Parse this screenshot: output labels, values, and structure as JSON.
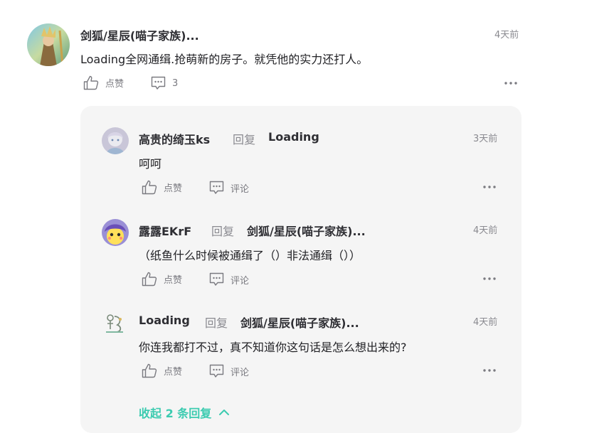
{
  "comment": {
    "username": "剑狐/星辰(喵子家族)...",
    "time": "4天前",
    "content": "Loading全网通缉.抢萌新的房子。就凭他的实力还打人。",
    "like_label": "点赞",
    "reply_count": "3"
  },
  "replies": [
    {
      "username": "高贵的绮玉ks",
      "reply_word": "回复",
      "target": "Loading",
      "time": "3天前",
      "content": "呵呵",
      "like_label": "点赞",
      "comment_label": "评论"
    },
    {
      "username": "露露EKrF",
      "reply_word": "回复",
      "target": "剑狐/星辰(喵子家族)...",
      "time": "4天前",
      "content": "（纸鱼什么时候被通缉了（）非法通缉（））",
      "like_label": "点赞",
      "comment_label": "评论"
    },
    {
      "username": "Loading",
      "reply_word": "回复",
      "target": "剑狐/星辰(喵子家族)...",
      "time": "4天前",
      "content": "你连我都打不过，真不知道你这句话是怎么想出来的?",
      "like_label": "点赞",
      "comment_label": "评论"
    }
  ],
  "collapse_label": "收起 2 条回复",
  "colors": {
    "accent": "#3ccbb0",
    "reply_background": "#f5f5f5",
    "secondary_text": "#8a8a90"
  },
  "icons": [
    "thumb-up-icon",
    "comment-icon",
    "more-icon",
    "chevron-up-icon"
  ]
}
